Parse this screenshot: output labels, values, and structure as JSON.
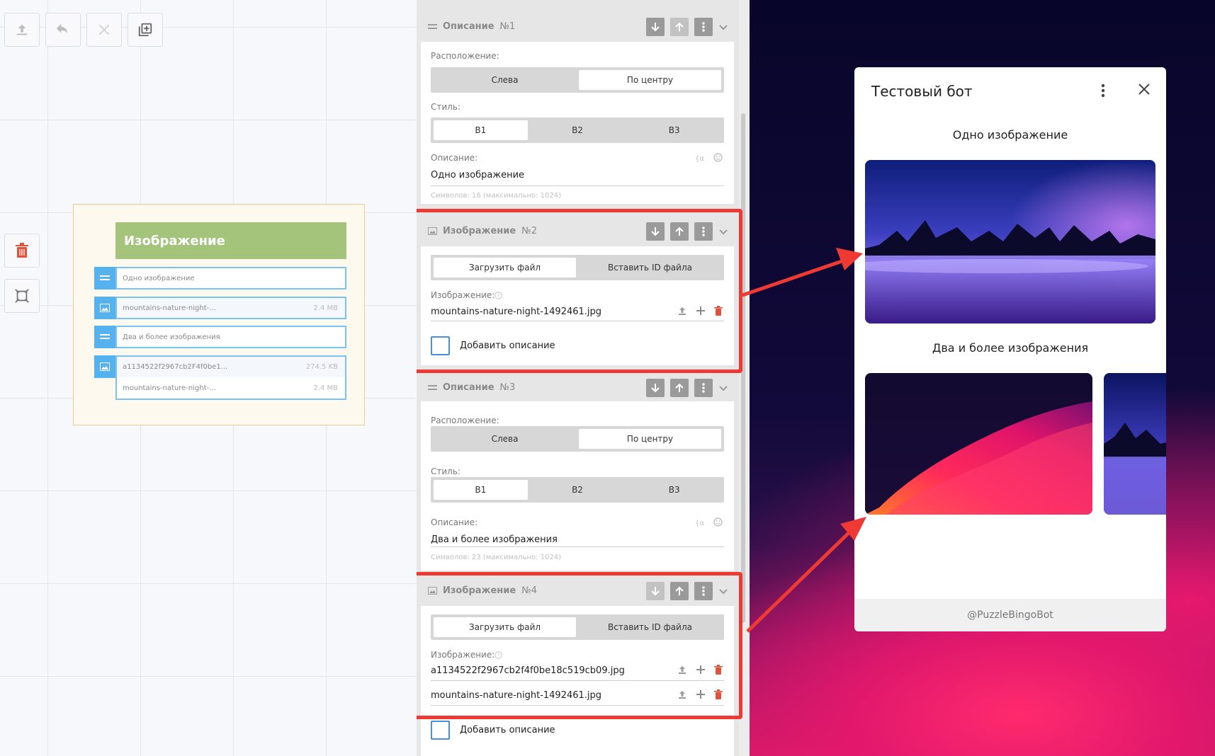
{
  "canvas": {
    "node": {
      "header": "Изображение",
      "rows": [
        {
          "kind": "text",
          "label": "Одно изображение",
          "size": ""
        },
        {
          "kind": "image",
          "label": "mountains-nature-night-...",
          "size": "2.4 MB"
        },
        {
          "kind": "text",
          "label": "Два и более изображения",
          "size": ""
        },
        {
          "kind": "image",
          "label": "a1134522f2967cb2F4f0be1...",
          "size": "274.5 KB"
        },
        {
          "kind": "image-sub",
          "label": "mountains-nature-night-...",
          "size": "2.4 MB"
        }
      ]
    }
  },
  "panel": {
    "labels": {
      "position": "Расположение:",
      "style": "Стиль:",
      "description": "Описание:",
      "image": "Изображение:",
      "add_description": "Добавить описание",
      "left": "Слева",
      "center": "По центру",
      "b1": "B1",
      "b2": "B2",
      "b3": "B3",
      "upload": "Загрузить файл",
      "paste_id": "Вставить ID файла"
    },
    "blocks": [
      {
        "type": "Описание",
        "num": "№1",
        "text": "Одно изображение",
        "hint": "Символов: 16 (максимально: 1024)"
      },
      {
        "type": "Изображение",
        "num": "№2",
        "files": [
          "mountains-nature-night-1492461.jpg"
        ]
      },
      {
        "type": "Описание",
        "num": "№3",
        "text": "Два и более изображения",
        "hint": "Символов: 23 (максимально: 1024)"
      },
      {
        "type": "Изображение",
        "num": "№4",
        "files": [
          "a1134522f2967cb2f4f0be18c519cb09.jpg",
          "mountains-nature-night-1492461.jpg"
        ]
      }
    ]
  },
  "preview": {
    "title": "Тестовый бот",
    "caption1": "Одно изображение",
    "caption2": "Два и более изображения",
    "footer": "@PuzzleBingoBot"
  },
  "colors": {
    "accent": "#55b2ef",
    "node_header": "#a3c47a",
    "highlight": "#ee3a33",
    "delete": "#e0533b"
  }
}
